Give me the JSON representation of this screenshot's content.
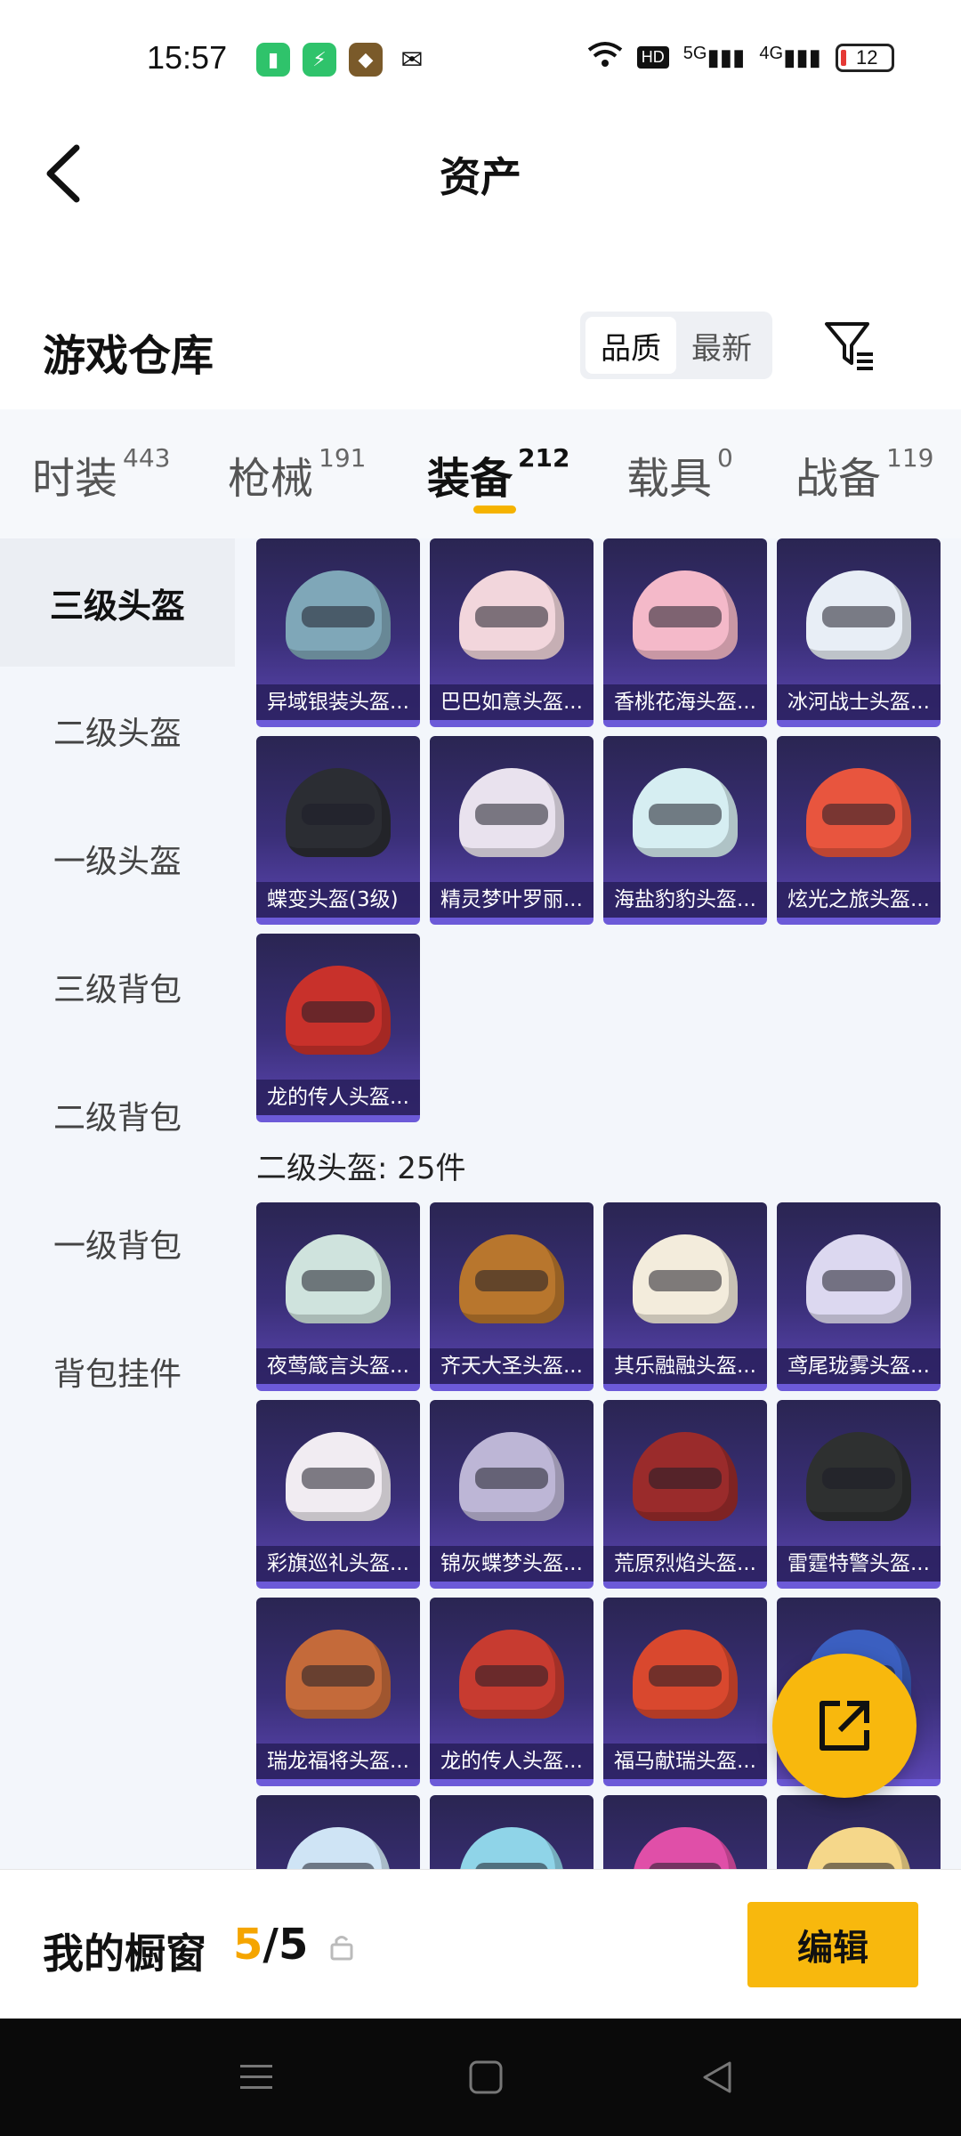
{
  "status_bar": {
    "time": "15:57",
    "network_1": "5G",
    "network_2": "4G",
    "battery": "12"
  },
  "nav": {
    "title": "资产"
  },
  "warehouse": {
    "title": "游戏仓库",
    "sort_options": [
      "品质",
      "最新"
    ],
    "active_sort": "品质"
  },
  "tabs": [
    {
      "label": "时装",
      "count": "443"
    },
    {
      "label": "枪械",
      "count": "191"
    },
    {
      "label": "装备",
      "count": "212"
    },
    {
      "label": "载具",
      "count": "0"
    },
    {
      "label": "战备",
      "count": "119"
    }
  ],
  "sidebar": {
    "items": [
      "三级头盔",
      "二级头盔",
      "一级头盔",
      "三级背包",
      "二级背包",
      "一级背包",
      "背包挂件"
    ]
  },
  "section_lvl3": {
    "items": [
      {
        "name": "异域银装头盔...",
        "color": "#7fa7b8"
      },
      {
        "name": "巴巴如意头盔...",
        "color": "#f2d6dc"
      },
      {
        "name": "香桃花海头盔...",
        "color": "#f4b9c9"
      },
      {
        "name": "冰河战士头盔...",
        "color": "#e8eef6"
      },
      {
        "name": "蝶变头盔(3级)",
        "color": "#2b2d33"
      },
      {
        "name": "精灵梦叶罗丽...",
        "color": "#e9e2ee"
      },
      {
        "name": "海盐豹豹头盔...",
        "color": "#d6eef2"
      },
      {
        "name": "炫光之旅头盔...",
        "color": "#e8553e"
      },
      {
        "name": "龙的传人头盔...",
        "color": "#c8312b"
      }
    ]
  },
  "section_lvl2": {
    "title": "二级头盔: 25件",
    "items": [
      {
        "name": "夜莺箴言头盔...",
        "color": "#cfe3dd"
      },
      {
        "name": "齐天大圣头盔...",
        "color": "#b8762d"
      },
      {
        "name": "其乐融融头盔...",
        "color": "#f3ecdc"
      },
      {
        "name": "鸢尾珑雾头盔...",
        "color": "#dcd8f0"
      },
      {
        "name": "彩旗巡礼头盔...",
        "color": "#f1ecf2"
      },
      {
        "name": "锦灰蝶梦头盔...",
        "color": "#bdb6d6"
      },
      {
        "name": "荒原烈焰头盔...",
        "color": "#9a2b2b"
      },
      {
        "name": "雷霆特警头盔...",
        "color": "#2e3030"
      },
      {
        "name": "瑞龙福将头盔...",
        "color": "#c46a3a"
      },
      {
        "name": "龙的传人头盔...",
        "color": "#c73b30"
      },
      {
        "name": "福马献瑞头盔...",
        "color": "#d9482e"
      },
      {
        "name": "",
        "color": "#3b5fc0"
      },
      {
        "name": "",
        "color": "#cfe4f5"
      },
      {
        "name": "",
        "color": "#8fd4e8"
      },
      {
        "name": "",
        "color": "#e04fa8"
      },
      {
        "name": "",
        "color": "#f5d78a"
      }
    ]
  },
  "showcase": {
    "label": "我的橱窗",
    "current": "5",
    "separator": "/",
    "total": "5",
    "edit_label": "编辑"
  }
}
